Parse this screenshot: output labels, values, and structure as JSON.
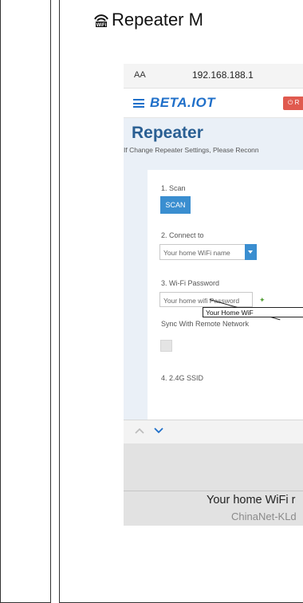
{
  "heading": {
    "title": "Repeater M"
  },
  "browser": {
    "text_size": "AA",
    "url": "192.168.188.1"
  },
  "navbar": {
    "brand": "BETA.IOT",
    "reboot_label": "R"
  },
  "page": {
    "title": "Repeater",
    "notice": "If Change Repeater Settings, Please Reconn"
  },
  "form": {
    "step1": "1. Scan",
    "scan_label": "SCAN",
    "step2": "2. Connect to",
    "network_placeholder": "Your home WiFi name",
    "step3": "3. Wi-Fi Password",
    "password_placeholder": "Your home wifi Password",
    "sync_label": "Sync With Remote Network",
    "step4": "4. 2.4G SSID"
  },
  "annotation": {
    "text": "Your Home WiF"
  },
  "picker": {
    "selected": "Your home WiFi r",
    "next": "ChinaNet-KLd"
  },
  "colors": {
    "accent": "#1f6fc9",
    "button": "#3a8ed0",
    "reboot": "#e05a4f",
    "page_bg": "#eaf0f7"
  }
}
